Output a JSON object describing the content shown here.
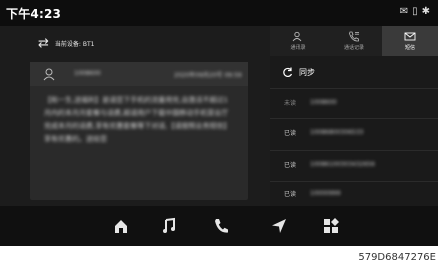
{
  "status": {
    "time": "下午4:23",
    "icons": [
      "mail-icon",
      "phone-lock-icon",
      "bluetooth-icon"
    ]
  },
  "device": {
    "label": "当前设备: BT1"
  },
  "message": {
    "sender": "1008600",
    "date": "2020年09月20号 09:59",
    "body": "【和一生,送福利】是请您下手机的流量用完,自激活不超过1月内的本月月套餐与话费,超请用户下载中国移动手机营业厅完成本月的话费,享有优惠套餐等下对话,【请按照业务短信】享有优惠的。送给您"
  },
  "tabs": [
    {
      "label": "通讯录",
      "icon": "contacts-icon",
      "active": false
    },
    {
      "label": "通话记录",
      "icon": "call-log-icon",
      "active": false
    },
    {
      "label": "短信",
      "icon": "sms-icon",
      "active": true
    }
  ],
  "sync": {
    "label": "同步"
  },
  "sms_list": [
    {
      "status": "未读",
      "number": "1008600"
    },
    {
      "status": "已读",
      "number": "10086800306533"
    },
    {
      "status": "已读",
      "number": "10086100303432656"
    },
    {
      "status": "已读",
      "number": "10000999"
    }
  ],
  "nav": [
    "home-icon",
    "music-icon",
    "phone-icon",
    "navigation-icon",
    "apps-icon"
  ],
  "image_code": "579D6847276E"
}
